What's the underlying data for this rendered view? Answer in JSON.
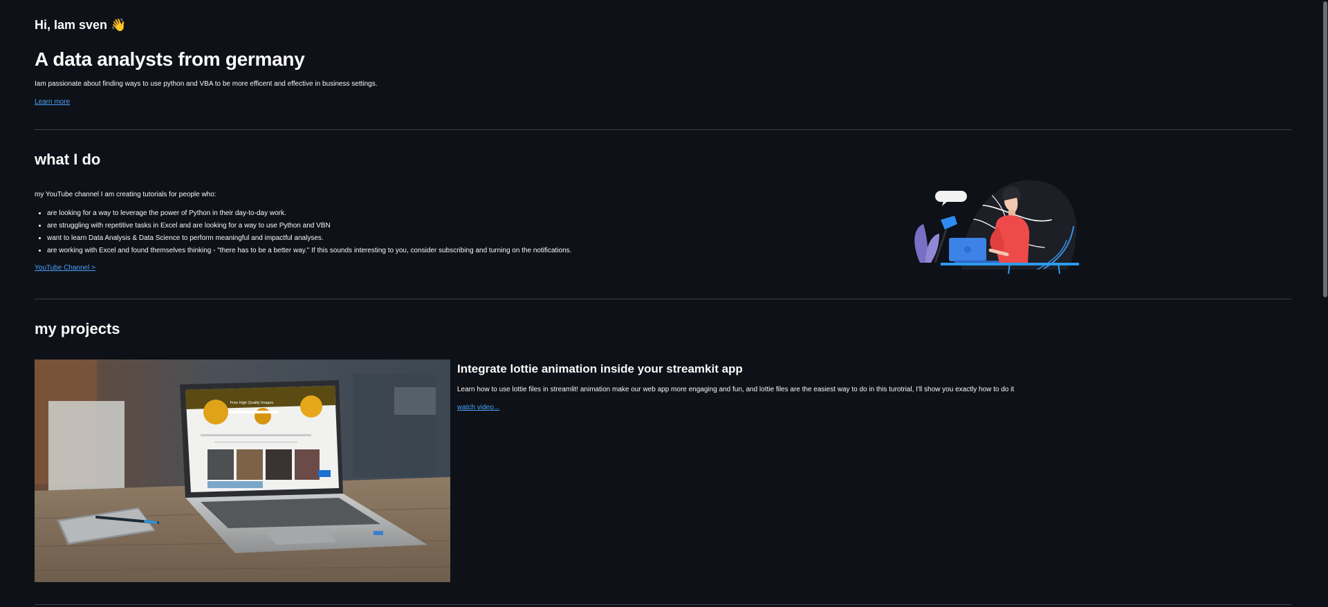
{
  "hero": {
    "greeting": "Hi, Iam sven 👋",
    "headline": "A data analysts from germany",
    "intro": "Iam passionate about finding ways to use python and VBA to be more efficent and effective in business settings.",
    "learn_more": "Learn more"
  },
  "what_i_do": {
    "title": "what I do",
    "intro": "my YouTube channel I am creating tutorials for people who:",
    "bullets": [
      "are looking for a way to leverage the power of Python in their day-to-day work.",
      "are struggling with repetitive tasks in Excel and are looking for a way to use Python and VBN",
      "want to learn Data Analysis & Data Science to perform meaningful and impactful analyses.",
      "are working with Excel and found themselves thinking - \"there has to be a better way.\" If this sounds interesting to you, consider subscribing and turning on the notifications."
    ],
    "link": "YouTube Channel >"
  },
  "projects": {
    "title": "my projects",
    "items": [
      {
        "title": "Integrate lottie animation inside your streamkit app",
        "description": "Learn how to use lottie files in streamlit! animation make our web app more engaging and fun, and lottie files are the easiest way to do in this turotrial, I'll show you exactly how to do it",
        "link": "watch video...",
        "screen_heading": "Free High Quality Images"
      }
    ]
  },
  "colors": {
    "background": "#0e1117",
    "text": "#fafafa",
    "link": "#4aa3ff",
    "divider": "#3b3f47"
  }
}
